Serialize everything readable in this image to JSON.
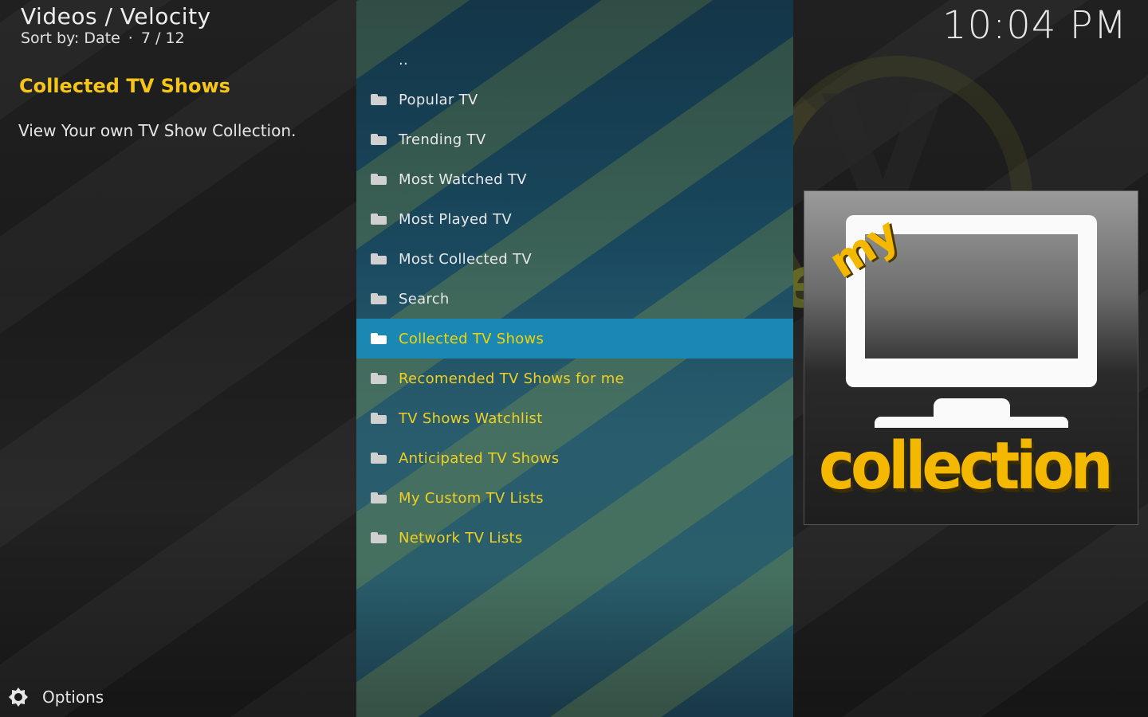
{
  "header": {
    "path": "Videos / Velocity",
    "sort": "Sort by: Date",
    "separator": "·",
    "position": "7 / 12"
  },
  "clock": "10:04 PM",
  "info": {
    "title": "Collected TV Shows",
    "description": "View Your own TV Show Collection."
  },
  "list": {
    "parent": "..",
    "items": [
      {
        "label": "Popular TV"
      },
      {
        "label": "Trending TV"
      },
      {
        "label": "Most Watched TV"
      },
      {
        "label": "Most Played TV"
      },
      {
        "label": "Most Collected TV"
      },
      {
        "label": "Search"
      },
      {
        "label": "Collected TV Shows"
      },
      {
        "label": "Recomended TV Shows for me"
      },
      {
        "label": "TV Shows Watchlist"
      },
      {
        "label": "Anticipated TV Shows"
      },
      {
        "label": "My Custom TV Lists"
      },
      {
        "label": "Network TV Lists"
      }
    ],
    "selected_index": 6
  },
  "thumbnail": {
    "my_text": "my",
    "collection_text": "collection"
  },
  "background": {
    "logo_text": "ve"
  },
  "options": {
    "label": "Options",
    "icon": "options-gear-icon"
  },
  "colors": {
    "accent_yellow": "#f5c518",
    "selected_row": "#1a88b3"
  }
}
